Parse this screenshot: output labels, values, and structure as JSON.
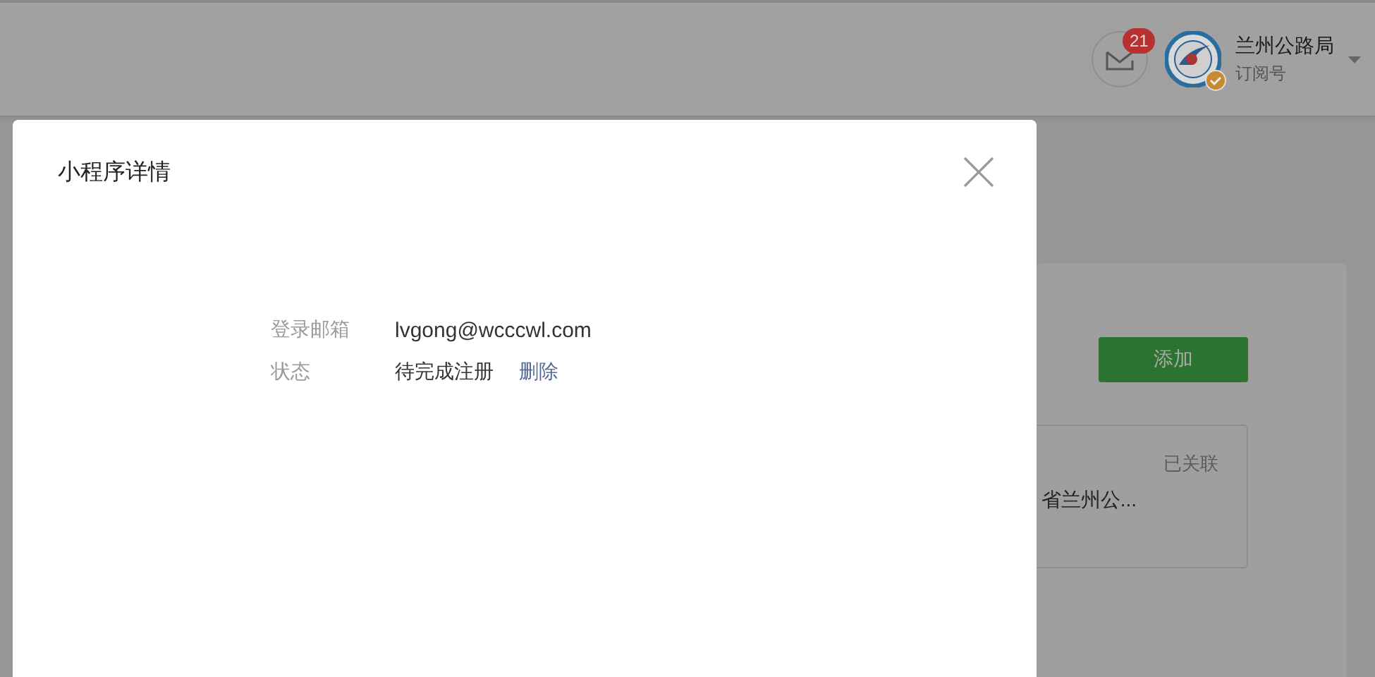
{
  "header": {
    "notification_count": "21",
    "account": {
      "name": "兰州公路局",
      "type": "订阅号",
      "verified": true
    }
  },
  "page": {
    "add_button": "添加",
    "card": {
      "status": "已关联",
      "name": "省兰州公..."
    }
  },
  "dialog": {
    "title": "小程序详情",
    "fields": [
      {
        "kind": "text",
        "label": "登录邮箱",
        "value": "lvgong@wcccwl.com"
      },
      {
        "kind": "status",
        "label": "状态",
        "value": "待完成注册",
        "action": "删除"
      }
    ]
  }
}
